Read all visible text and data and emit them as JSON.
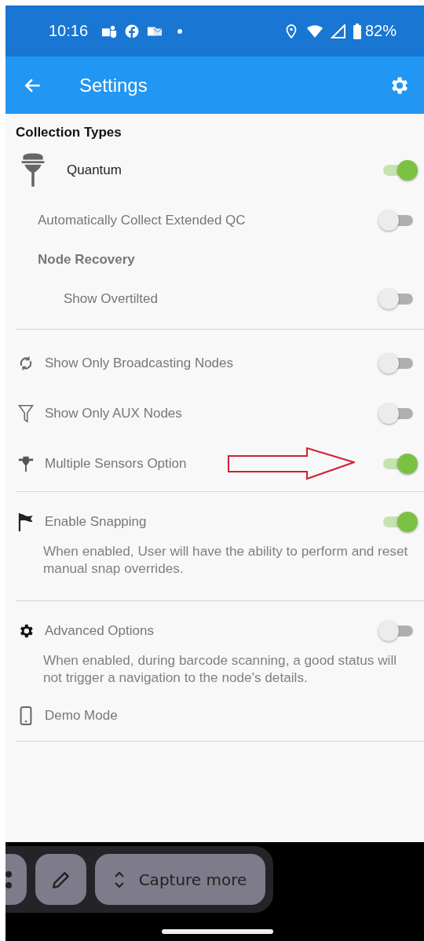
{
  "status_bar": {
    "time": "10:16",
    "battery": "82%"
  },
  "app_bar": {
    "title": "Settings"
  },
  "sections": [
    {
      "title": "Collection Types",
      "items": [
        {
          "kind": "toggle",
          "label": "Quantum",
          "on": true,
          "children": [
            {
              "kind": "toggle",
              "label": "Automatically Collect Extended QC",
              "on": false
            },
            {
              "kind": "group",
              "label": "Node Recovery",
              "children": [
                {
                  "kind": "toggle",
                  "label": "Show Overtilted",
                  "on": false
                }
              ]
            }
          ]
        }
      ]
    },
    {
      "items": [
        {
          "kind": "toggle",
          "label": "Show Only Broadcasting Nodes",
          "on": false
        },
        {
          "kind": "toggle",
          "label": "Show Only AUX Nodes",
          "on": false
        },
        {
          "kind": "toggle",
          "label": "Multiple Sensors Option",
          "on": true
        }
      ]
    },
    {
      "items": [
        {
          "kind": "toggle",
          "label": "Enable Snapping",
          "on": true,
          "description": "When enabled, User will have the ability to perform and reset manual snap overrides."
        }
      ]
    },
    {
      "items": [
        {
          "kind": "toggle",
          "label": "Advanced Options",
          "on": false,
          "description": "When enabled, during barcode scanning, a good status will not trigger a navigation to the node's details."
        },
        {
          "kind": "link",
          "label": "Demo Mode"
        }
      ]
    }
  ],
  "toolbar": {
    "buttons": [
      {
        "kind": "more"
      },
      {
        "kind": "edit"
      },
      {
        "kind": "scroll",
        "label": "Capture more"
      }
    ]
  }
}
